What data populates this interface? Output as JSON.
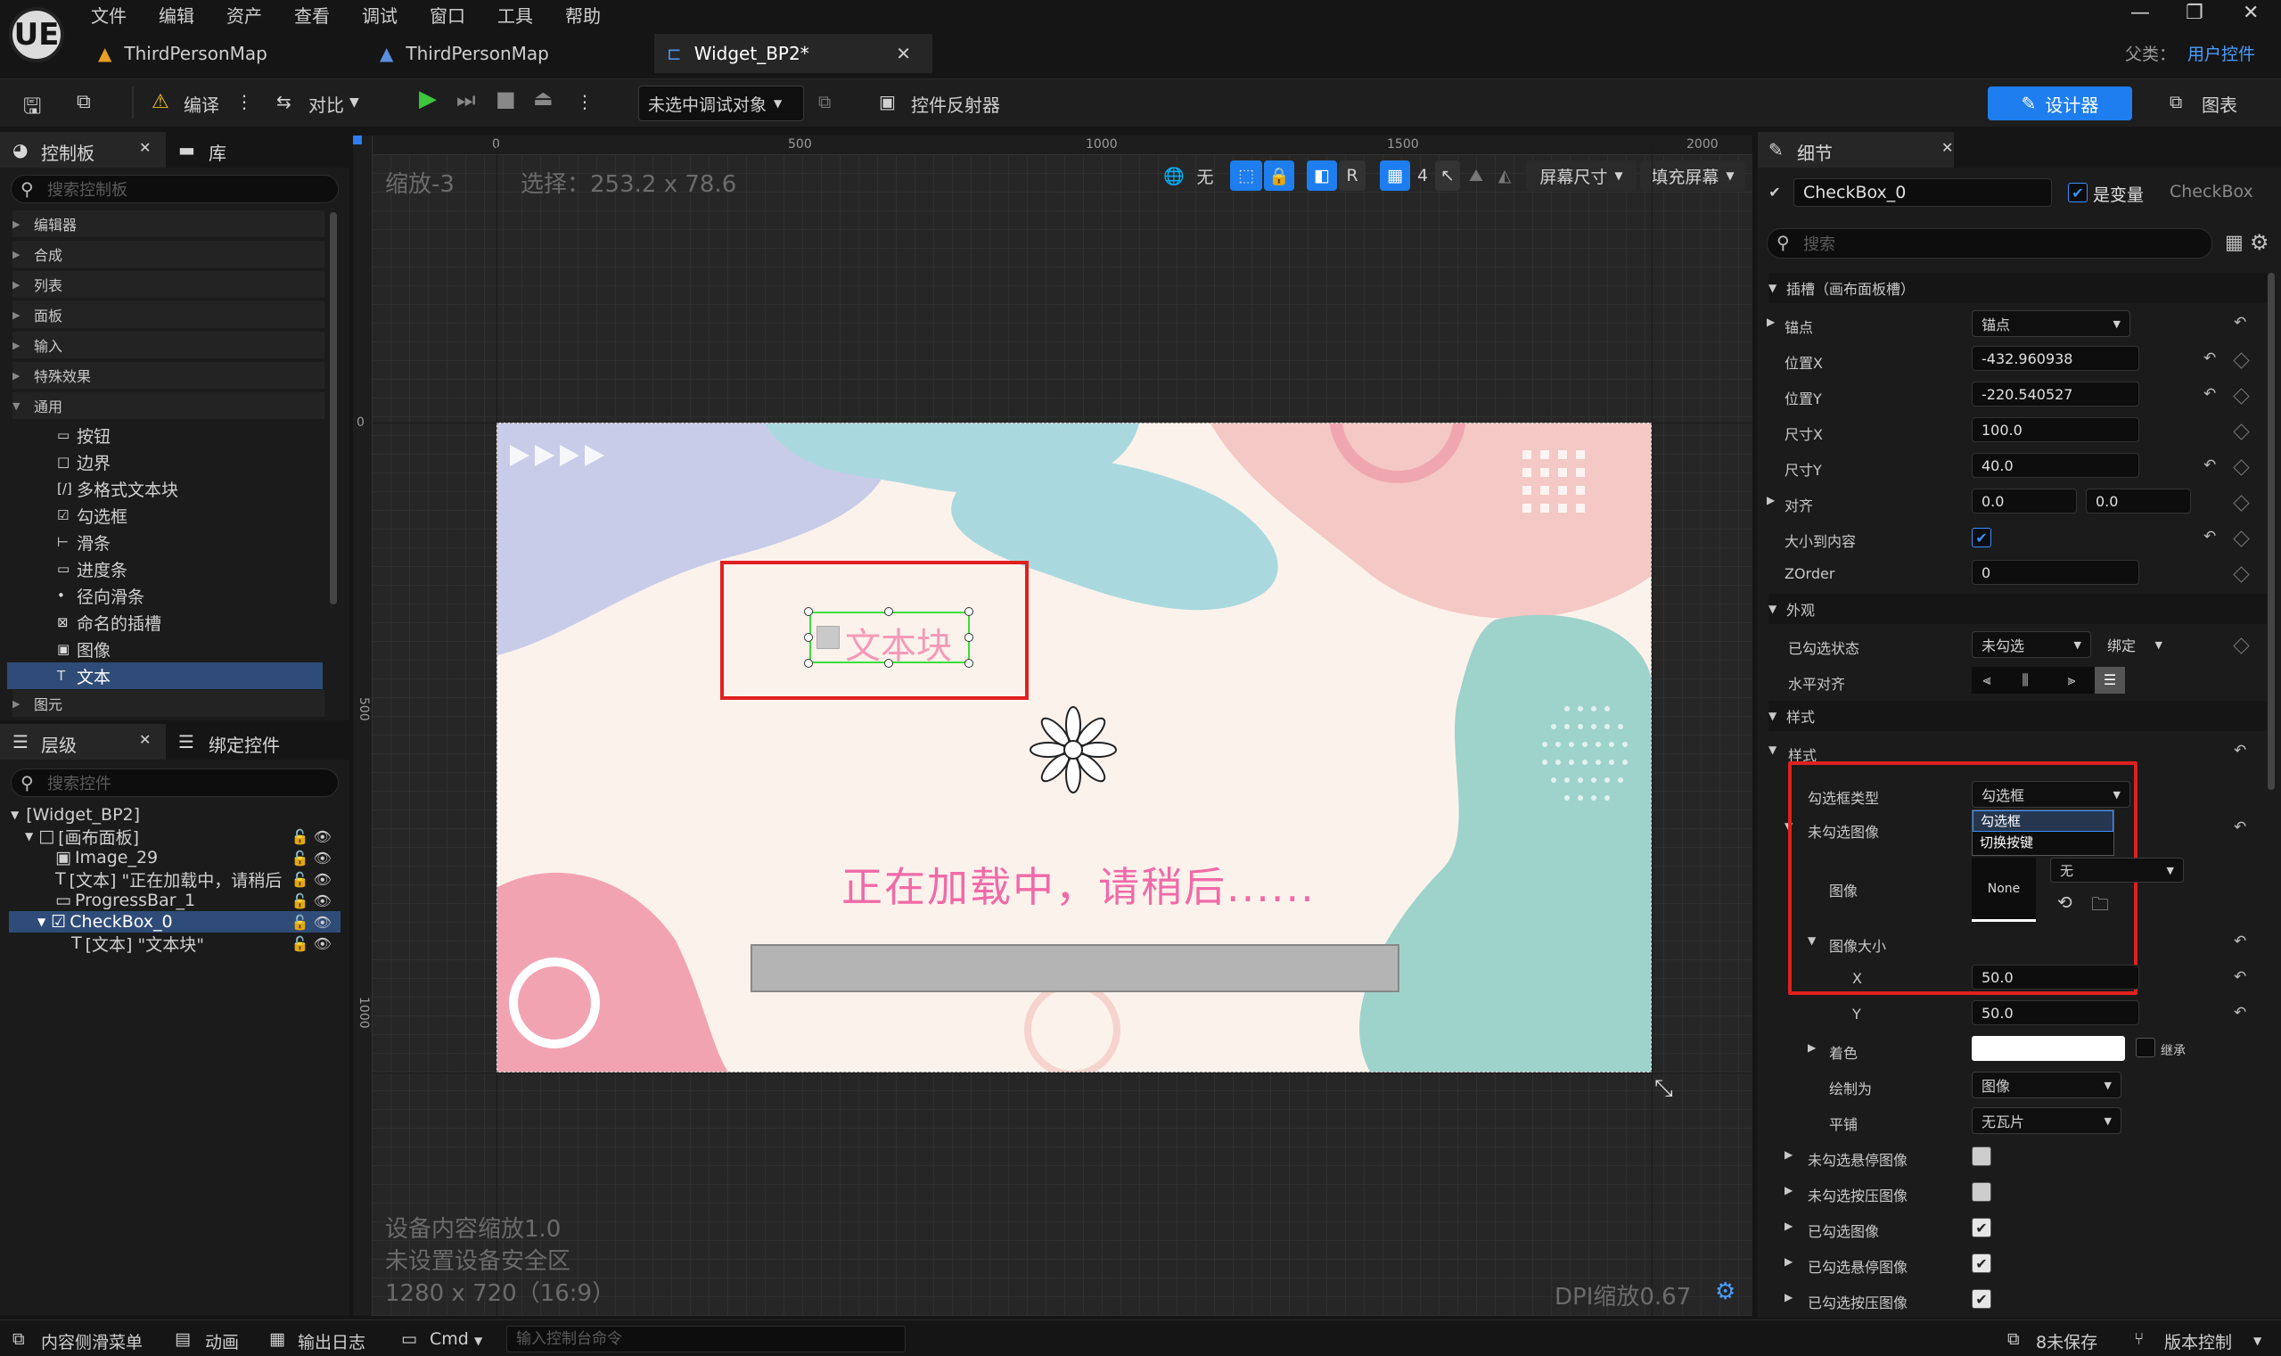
{
  "menubar": {
    "logo": "UE",
    "items": [
      "文件",
      "编辑",
      "资产",
      "查看",
      "调试",
      "窗口",
      "工具",
      "帮助"
    ],
    "tabs": [
      "ThirdPersonMap",
      "ThirdPersonMap",
      "Widget_BP2*"
    ],
    "parent_class_label": "父类：",
    "parent_class_value": "用户控件",
    "window_buttons": [
      "—",
      "❐",
      "✕"
    ]
  },
  "toolbar": {
    "compile": "编译",
    "diff": "对比",
    "debug_target": "未选中调试对象",
    "widget_reflector": "控件反射器",
    "designer": "设计器",
    "graph": "图表"
  },
  "palette": {
    "tab_label": "控制板",
    "library_label": "库",
    "search_placeholder": "搜索控制板",
    "categories": [
      "编辑器",
      "合成",
      "列表",
      "面板",
      "输入",
      "特殊效果",
      "通用"
    ],
    "common_items": [
      {
        "icon": "▭",
        "label": "按钮"
      },
      {
        "icon": "□",
        "label": "边界"
      },
      {
        "icon": "[/]",
        "label": "多格式文本块"
      },
      {
        "icon": "☑",
        "label": "勾选框"
      },
      {
        "icon": "⊢",
        "label": "滑条"
      },
      {
        "icon": "▭",
        "label": "进度条"
      },
      {
        "icon": "•",
        "label": "径向滑条"
      },
      {
        "icon": "⊠",
        "label": "命名的插槽"
      },
      {
        "icon": "▣",
        "label": "图像"
      },
      {
        "icon": "T",
        "label": "文本"
      }
    ],
    "last_category": "图元"
  },
  "hierarchy": {
    "tab_label": "层级",
    "bind_label": "绑定控件",
    "search_placeholder": "搜索控件",
    "items": [
      {
        "label": "[Widget_BP2]"
      },
      {
        "label": "[画布面板]"
      },
      {
        "label": "Image_29"
      },
      {
        "label": "[文本] \"正在加载中，请稍后"
      },
      {
        "label": "ProgressBar_1"
      },
      {
        "label": "CheckBox_0"
      },
      {
        "label": "[文本] \"文本块\""
      }
    ]
  },
  "viewport": {
    "zoom": "缩放-3",
    "selection": "选择：253.2 x 78.6",
    "ruler_top": [
      "0",
      "500",
      "1000",
      "1500",
      "2000"
    ],
    "ruler_left": [
      "0",
      "500",
      "1000"
    ],
    "btn_none": "无",
    "btn_r": "R",
    "btn_grid_num": "4",
    "screen_size": "屏幕尺寸",
    "fill_screen": "填充屏幕",
    "device_scale": "设备内容缩放1.0",
    "safe_zone": "未设置设备安全区",
    "resolution": "1280 x 720（16:9）",
    "dpi": "DPI缩放0.67",
    "canvas_text_block": "文本块",
    "loading_text": "正在加载中，请稍后......",
    "colors": {
      "pink_text": "#f06aa8",
      "selection_red": "#e02020",
      "selection_green": "#3adf3a"
    }
  },
  "details": {
    "tab_label": "细节",
    "name": "CheckBox_0",
    "is_variable": "是变量",
    "class": "CheckBox",
    "search_placeholder": "搜索",
    "slot_section": "插槽（画布面板槽）",
    "anchor_label": "锚点",
    "anchor_value": "锚点",
    "pos_x_label": "位置X",
    "pos_x": "-432.960938",
    "pos_y_label": "位置Y",
    "pos_y": "-220.540527",
    "size_x_label": "尺寸X",
    "size_x": "100.0",
    "size_y_label": "尺寸Y",
    "size_y": "40.0",
    "align_label": "对齐",
    "align_x": "0.0",
    "align_y": "0.0",
    "autosize_label": "大小到内容",
    "zorder_label": "ZOrder",
    "zorder": "0",
    "appearance_section": "外观",
    "checked_state_label": "已勾选状态",
    "checked_state_value": "未勾选",
    "bind": "绑定",
    "halign_label": "水平对齐",
    "style_section": "样式",
    "style_sub": "样式",
    "checkbox_type_label": "勾选框类型",
    "checkbox_type_value": "勾选框",
    "dropdown_options": [
      "勾选框",
      "切换按键"
    ],
    "unchecked_image_label": "未勾选图像",
    "image_label": "图像",
    "image_none": "None",
    "image_none_dd": "无",
    "image_size_label": "图像大小",
    "x_label": "X",
    "x_value": "50.0",
    "y_label": "Y",
    "y_value": "50.0",
    "tint_label": "着色",
    "inherit": "继承",
    "draw_as_label": "绘制为",
    "draw_as_value": "图像",
    "tiling_label": "平铺",
    "tiling_value": "无瓦片",
    "more_rows": [
      "未勾选悬停图像",
      "未勾选按压图像",
      "已勾选图像",
      "已勾选悬停图像",
      "已勾选按压图像"
    ]
  },
  "statusbar": {
    "content_drawer": "内容侧滑菜单",
    "animation": "动画",
    "output_log": "输出日志",
    "cmd": "Cmd",
    "console_placeholder": "输入控制台命令",
    "unsaved": "8未保存",
    "source_control": "版本控制"
  }
}
